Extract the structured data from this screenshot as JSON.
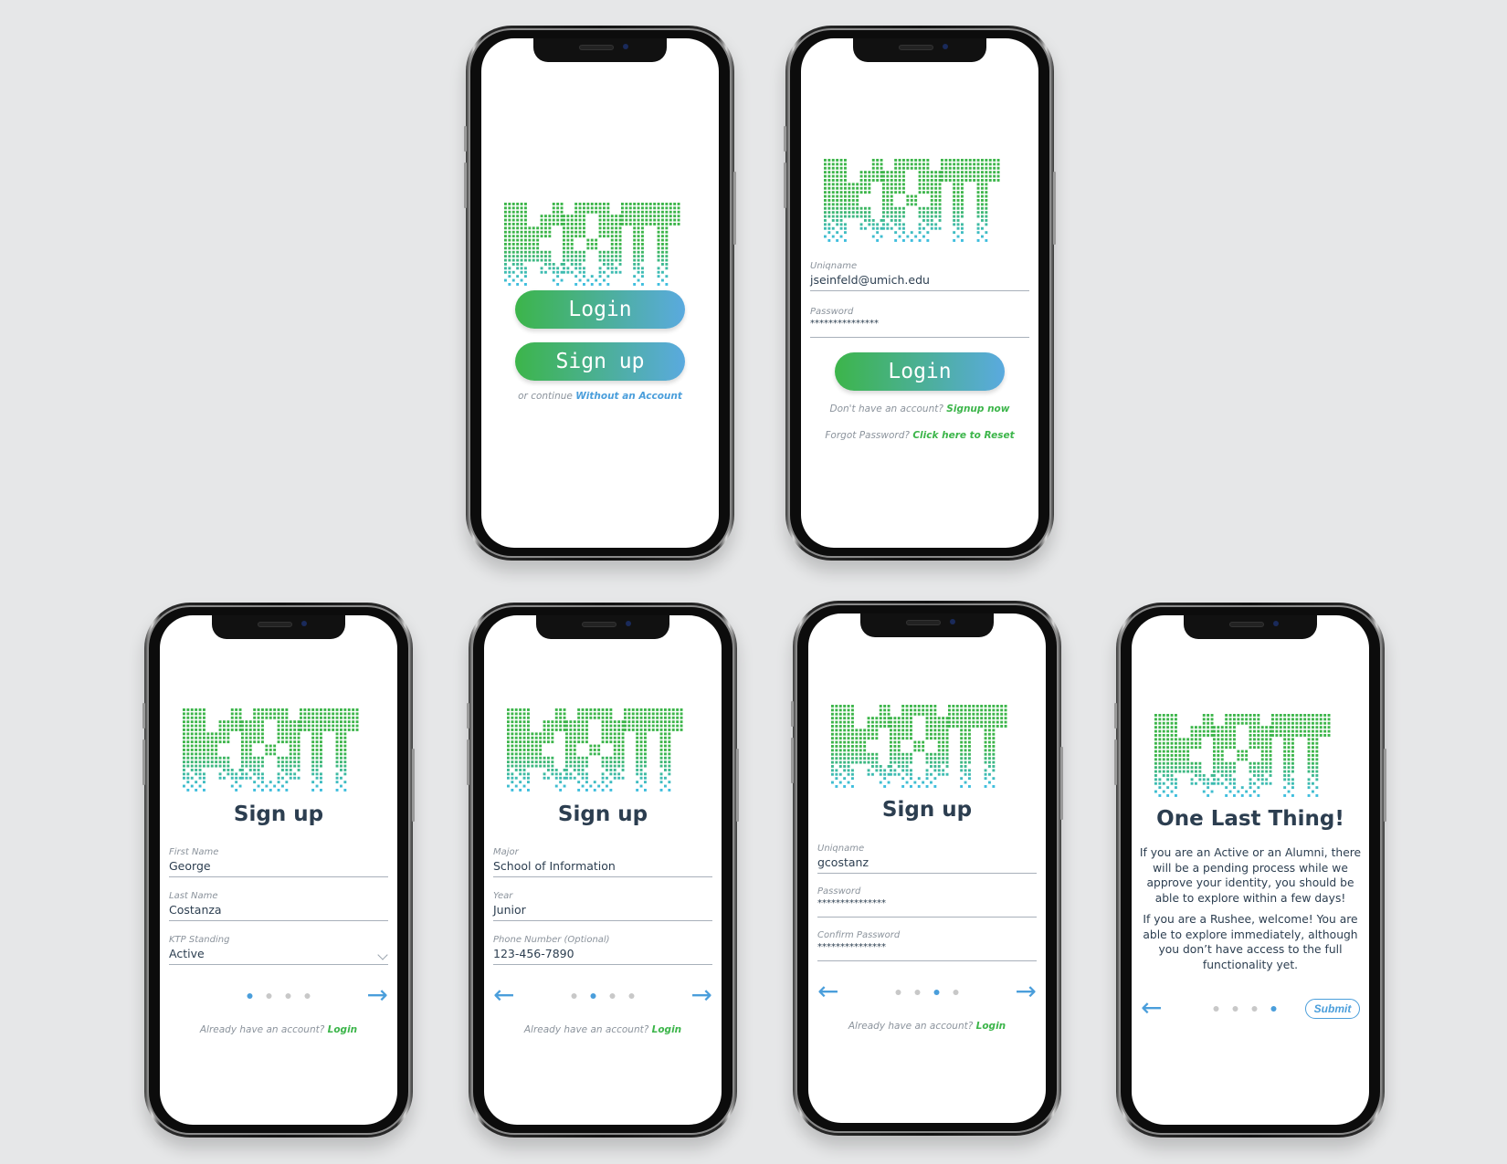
{
  "colors": {
    "background": "#e6e7e8",
    "accent_green": "#3cb54a",
    "accent_blue": "#4a9edb",
    "text_dark": "#2c3e50",
    "text_muted": "#8b939c"
  },
  "logo": {
    "text": "KOT",
    "icon": "pixel-logo-icon"
  },
  "screens": {
    "welcome": {
      "login_button": "Login",
      "signup_button": "Sign up",
      "continue_prefix": "or continue",
      "continue_link": "Without an Account"
    },
    "login": {
      "uniqname_label": "Uniqname",
      "uniqname_value": "jseinfeld@umich.edu",
      "password_label": "Password",
      "password_value": "***************",
      "login_button": "Login",
      "no_account_prefix": "Don't have an account?",
      "no_account_link": "Signup now",
      "forgot_prefix": "Forgot Password?",
      "forgot_link": "Click here to Reset"
    },
    "signup1": {
      "title": "Sign up",
      "first_name_label": "First Name",
      "first_name_value": "George",
      "last_name_label": "Last Name",
      "last_name_value": "Costanza",
      "standing_label": "KTP Standing",
      "standing_value": "Active",
      "step": 1,
      "total_steps": 4,
      "already_prefix": "Already have an account?",
      "already_link": "Login"
    },
    "signup2": {
      "title": "Sign up",
      "major_label": "Major",
      "major_value": "School of Information",
      "year_label": "Year",
      "year_value": "Junior",
      "phone_label": "Phone Number (Optional)",
      "phone_value": "123-456-7890",
      "step": 2,
      "total_steps": 4,
      "already_prefix": "Already have an account?",
      "already_link": "Login"
    },
    "signup3": {
      "title": "Sign up",
      "uniqname_label": "Uniqname",
      "uniqname_value": "gcostanz",
      "password_label": "Password",
      "password_value": "***************",
      "confirm_label": "Confirm Password",
      "confirm_value": "***************",
      "step": 3,
      "total_steps": 4,
      "already_prefix": "Already have an account?",
      "already_link": "Login"
    },
    "final": {
      "title": "One Last Thing!",
      "paragraph1": "If you are an Active or an Alumni, there will be a pending process while we approve your identity, you should be able to explore within a few days!",
      "paragraph2": "If you are a Rushee, welcome! You are able to explore immediately, although you don’t have access to the full functionality yet.",
      "step": 4,
      "total_steps": 4,
      "submit_button": "Submit"
    }
  },
  "icons": {
    "next": "→",
    "back": "←"
  }
}
